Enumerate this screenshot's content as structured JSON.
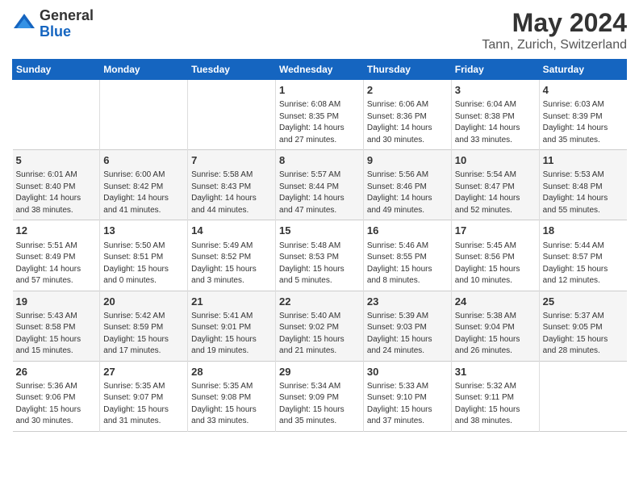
{
  "logo": {
    "general": "General",
    "blue": "Blue"
  },
  "header": {
    "title": "May 2024",
    "subtitle": "Tann, Zurich, Switzerland"
  },
  "days_of_week": [
    "Sunday",
    "Monday",
    "Tuesday",
    "Wednesday",
    "Thursday",
    "Friday",
    "Saturday"
  ],
  "weeks": [
    {
      "cells": [
        {
          "day": "",
          "content": ""
        },
        {
          "day": "",
          "content": ""
        },
        {
          "day": "",
          "content": ""
        },
        {
          "day": "1",
          "content": "Sunrise: 6:08 AM\nSunset: 8:35 PM\nDaylight: 14 hours\nand 27 minutes."
        },
        {
          "day": "2",
          "content": "Sunrise: 6:06 AM\nSunset: 8:36 PM\nDaylight: 14 hours\nand 30 minutes."
        },
        {
          "day": "3",
          "content": "Sunrise: 6:04 AM\nSunset: 8:38 PM\nDaylight: 14 hours\nand 33 minutes."
        },
        {
          "day": "4",
          "content": "Sunrise: 6:03 AM\nSunset: 8:39 PM\nDaylight: 14 hours\nand 35 minutes."
        }
      ]
    },
    {
      "cells": [
        {
          "day": "5",
          "content": "Sunrise: 6:01 AM\nSunset: 8:40 PM\nDaylight: 14 hours\nand 38 minutes."
        },
        {
          "day": "6",
          "content": "Sunrise: 6:00 AM\nSunset: 8:42 PM\nDaylight: 14 hours\nand 41 minutes."
        },
        {
          "day": "7",
          "content": "Sunrise: 5:58 AM\nSunset: 8:43 PM\nDaylight: 14 hours\nand 44 minutes."
        },
        {
          "day": "8",
          "content": "Sunrise: 5:57 AM\nSunset: 8:44 PM\nDaylight: 14 hours\nand 47 minutes."
        },
        {
          "day": "9",
          "content": "Sunrise: 5:56 AM\nSunset: 8:46 PM\nDaylight: 14 hours\nand 49 minutes."
        },
        {
          "day": "10",
          "content": "Sunrise: 5:54 AM\nSunset: 8:47 PM\nDaylight: 14 hours\nand 52 minutes."
        },
        {
          "day": "11",
          "content": "Sunrise: 5:53 AM\nSunset: 8:48 PM\nDaylight: 14 hours\nand 55 minutes."
        }
      ]
    },
    {
      "cells": [
        {
          "day": "12",
          "content": "Sunrise: 5:51 AM\nSunset: 8:49 PM\nDaylight: 14 hours\nand 57 minutes."
        },
        {
          "day": "13",
          "content": "Sunrise: 5:50 AM\nSunset: 8:51 PM\nDaylight: 15 hours\nand 0 minutes."
        },
        {
          "day": "14",
          "content": "Sunrise: 5:49 AM\nSunset: 8:52 PM\nDaylight: 15 hours\nand 3 minutes."
        },
        {
          "day": "15",
          "content": "Sunrise: 5:48 AM\nSunset: 8:53 PM\nDaylight: 15 hours\nand 5 minutes."
        },
        {
          "day": "16",
          "content": "Sunrise: 5:46 AM\nSunset: 8:55 PM\nDaylight: 15 hours\nand 8 minutes."
        },
        {
          "day": "17",
          "content": "Sunrise: 5:45 AM\nSunset: 8:56 PM\nDaylight: 15 hours\nand 10 minutes."
        },
        {
          "day": "18",
          "content": "Sunrise: 5:44 AM\nSunset: 8:57 PM\nDaylight: 15 hours\nand 12 minutes."
        }
      ]
    },
    {
      "cells": [
        {
          "day": "19",
          "content": "Sunrise: 5:43 AM\nSunset: 8:58 PM\nDaylight: 15 hours\nand 15 minutes."
        },
        {
          "day": "20",
          "content": "Sunrise: 5:42 AM\nSunset: 8:59 PM\nDaylight: 15 hours\nand 17 minutes."
        },
        {
          "day": "21",
          "content": "Sunrise: 5:41 AM\nSunset: 9:01 PM\nDaylight: 15 hours\nand 19 minutes."
        },
        {
          "day": "22",
          "content": "Sunrise: 5:40 AM\nSunset: 9:02 PM\nDaylight: 15 hours\nand 21 minutes."
        },
        {
          "day": "23",
          "content": "Sunrise: 5:39 AM\nSunset: 9:03 PM\nDaylight: 15 hours\nand 24 minutes."
        },
        {
          "day": "24",
          "content": "Sunrise: 5:38 AM\nSunset: 9:04 PM\nDaylight: 15 hours\nand 26 minutes."
        },
        {
          "day": "25",
          "content": "Sunrise: 5:37 AM\nSunset: 9:05 PM\nDaylight: 15 hours\nand 28 minutes."
        }
      ]
    },
    {
      "cells": [
        {
          "day": "26",
          "content": "Sunrise: 5:36 AM\nSunset: 9:06 PM\nDaylight: 15 hours\nand 30 minutes."
        },
        {
          "day": "27",
          "content": "Sunrise: 5:35 AM\nSunset: 9:07 PM\nDaylight: 15 hours\nand 31 minutes."
        },
        {
          "day": "28",
          "content": "Sunrise: 5:35 AM\nSunset: 9:08 PM\nDaylight: 15 hours\nand 33 minutes."
        },
        {
          "day": "29",
          "content": "Sunrise: 5:34 AM\nSunset: 9:09 PM\nDaylight: 15 hours\nand 35 minutes."
        },
        {
          "day": "30",
          "content": "Sunrise: 5:33 AM\nSunset: 9:10 PM\nDaylight: 15 hours\nand 37 minutes."
        },
        {
          "day": "31",
          "content": "Sunrise: 5:32 AM\nSunset: 9:11 PM\nDaylight: 15 hours\nand 38 minutes."
        },
        {
          "day": "",
          "content": ""
        }
      ]
    }
  ]
}
